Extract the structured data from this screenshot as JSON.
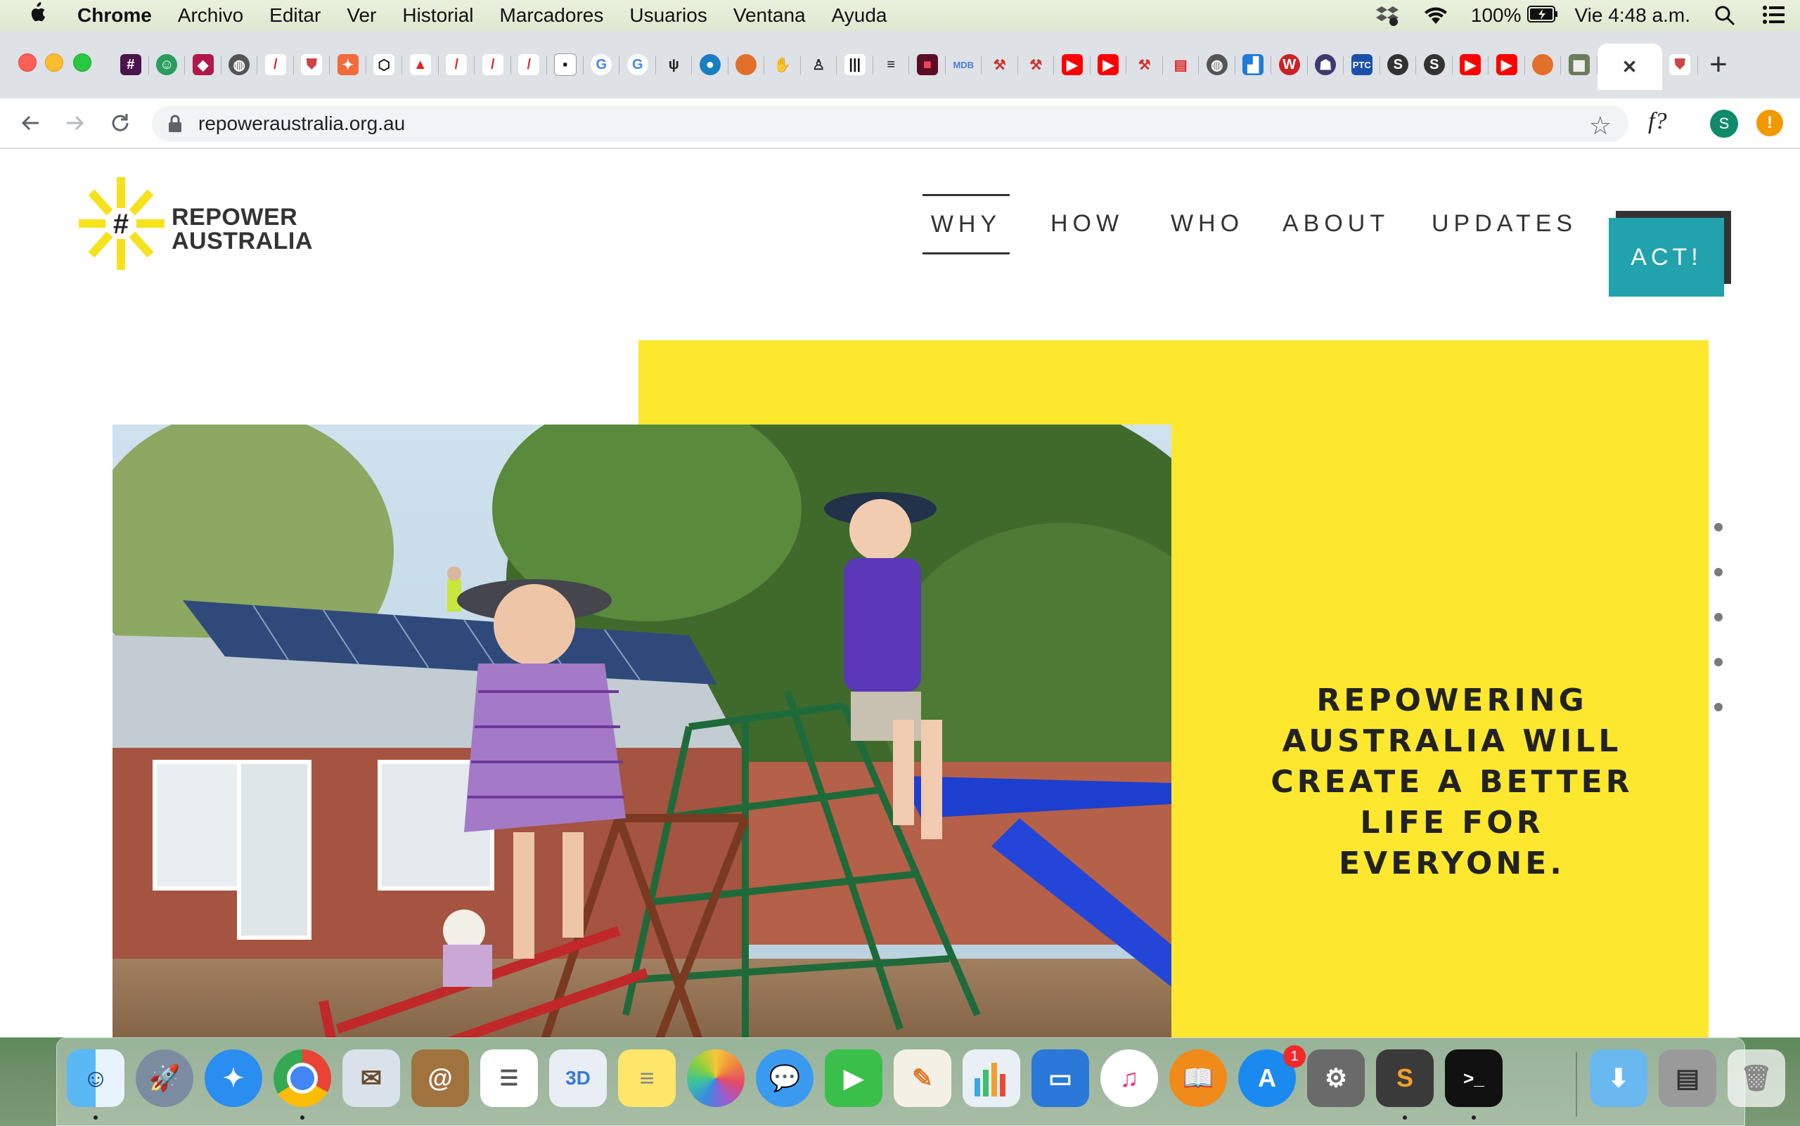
{
  "menubar": {
    "app_name": "Chrome",
    "items": [
      "Archivo",
      "Editar",
      "Ver",
      "Historial",
      "Marcadores",
      "Usuarios",
      "Ventana",
      "Ayuda"
    ],
    "battery": "100%",
    "clock": "Vie 4:48 a.m."
  },
  "browser": {
    "url": "repoweraustralia.org.au",
    "extension_label": "f?",
    "profile_initial": "S",
    "warning_symbol": "!",
    "new_tab_symbol": "+",
    "close_tab_symbol": "✕"
  },
  "site": {
    "logo_line1": "REPOWER",
    "logo_line2": "AUSTRALIA",
    "nav": [
      "WHY",
      "HOW",
      "WHO",
      "ABOUT",
      "UPDATES"
    ],
    "nav_active": "WHY",
    "cta": "ACT!",
    "tagline": "REPOWERING AUSTRALIA WILL CREATE A BETTER LIFE FOR EVERYONE.",
    "accent_teal": "#22a2ad",
    "accent_yellow": "#fde82f"
  },
  "dock": {
    "app_store_badge": "1"
  }
}
